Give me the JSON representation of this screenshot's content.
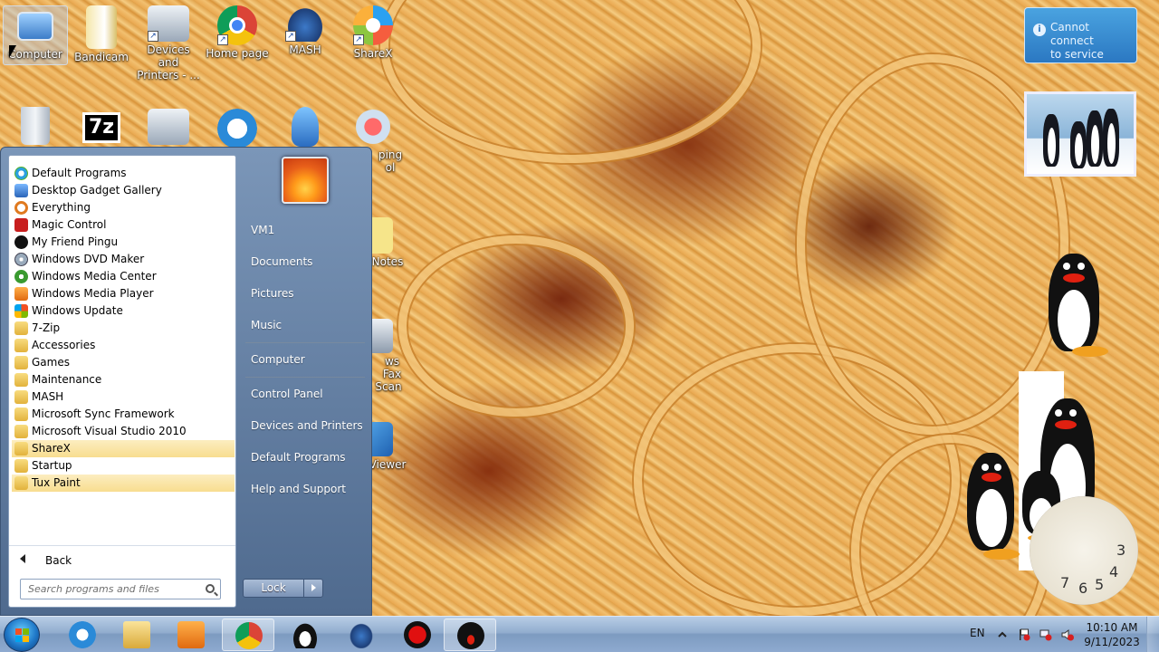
{
  "desktop": {
    "icons": [
      {
        "label": "Computer",
        "icon": "computer-icon"
      },
      {
        "label": "Bandicam",
        "icon": "bandicam-icon"
      },
      {
        "label": "Devices and Printers - ...",
        "line1": "Devices and",
        "line2": "Printers - ...",
        "icon": "devices-printers-icon"
      },
      {
        "label": "Home page",
        "icon": "chrome-icon"
      },
      {
        "label": "MASH",
        "icon": "mash-icon"
      },
      {
        "label": "ShareX",
        "icon": "sharex-icon"
      }
    ],
    "partial_labels": {
      "snipping_1": "ping",
      "snipping_2": "ol",
      "notes": "Notes",
      "fax_1": "ws Fax",
      "fax_2": "Scan",
      "viewer": "Viewer"
    }
  },
  "gadgets": {
    "message": {
      "line1": "Cannot connect",
      "line2": "to service",
      "icon": "info-icon"
    },
    "clock": {
      "numerals": [
        "3",
        "4",
        "5",
        "6",
        "7"
      ]
    }
  },
  "start_menu": {
    "programs": [
      {
        "label": "Default Programs",
        "icon": "default-programs-icon",
        "highlight": false
      },
      {
        "label": "Desktop Gadget Gallery",
        "icon": "gadget-gallery-icon",
        "highlight": false
      },
      {
        "label": "Everything",
        "icon": "everything-icon",
        "highlight": false
      },
      {
        "label": "Magic Control",
        "icon": "magic-control-icon",
        "highlight": false
      },
      {
        "label": "My Friend Pingu",
        "icon": "pingu-icon",
        "highlight": false
      },
      {
        "label": "Windows DVD Maker",
        "icon": "dvd-maker-icon",
        "highlight": false
      },
      {
        "label": "Windows Media Center",
        "icon": "media-center-icon",
        "highlight": false
      },
      {
        "label": "Windows Media Player",
        "icon": "media-player-icon",
        "highlight": false
      },
      {
        "label": "Windows Update",
        "icon": "windows-update-icon",
        "highlight": false
      },
      {
        "label": "7-Zip",
        "icon": "folder-icon",
        "highlight": false
      },
      {
        "label": "Accessories",
        "icon": "folder-icon",
        "highlight": false
      },
      {
        "label": "Games",
        "icon": "folder-icon",
        "highlight": false
      },
      {
        "label": "Maintenance",
        "icon": "folder-icon",
        "highlight": false
      },
      {
        "label": "MASH",
        "icon": "folder-icon",
        "highlight": false
      },
      {
        "label": "Microsoft Sync Framework",
        "icon": "folder-icon",
        "highlight": false
      },
      {
        "label": "Microsoft Visual Studio 2010",
        "icon": "folder-icon",
        "highlight": false
      },
      {
        "label": "ShareX",
        "icon": "folder-icon",
        "highlight": true
      },
      {
        "label": "Startup",
        "icon": "folder-icon",
        "highlight": false
      },
      {
        "label": "Tux Paint",
        "icon": "folder-icon",
        "highlight": true
      }
    ],
    "back_label": "Back",
    "search_placeholder": "Search programs and files",
    "right_links": [
      "VM1",
      "Documents",
      "Pictures",
      "Music",
      "Computer",
      "Control Panel",
      "Devices and Printers",
      "Default Programs",
      "Help and Support"
    ],
    "lock_label": "Lock"
  },
  "taskbar": {
    "pinned": [
      "internet-explorer-icon",
      "explorer-folder-icon",
      "media-player-icon",
      "chrome-icon",
      "tux-icon",
      "mash-icon",
      "record-icon",
      "pingu-icon"
    ],
    "language": "EN",
    "time": "10:10 AM",
    "date": "9/11/2023"
  },
  "colors": {
    "highlight": "#f8dd8f",
    "menu_right": "#5a7599",
    "taskbar": "#92adce"
  }
}
